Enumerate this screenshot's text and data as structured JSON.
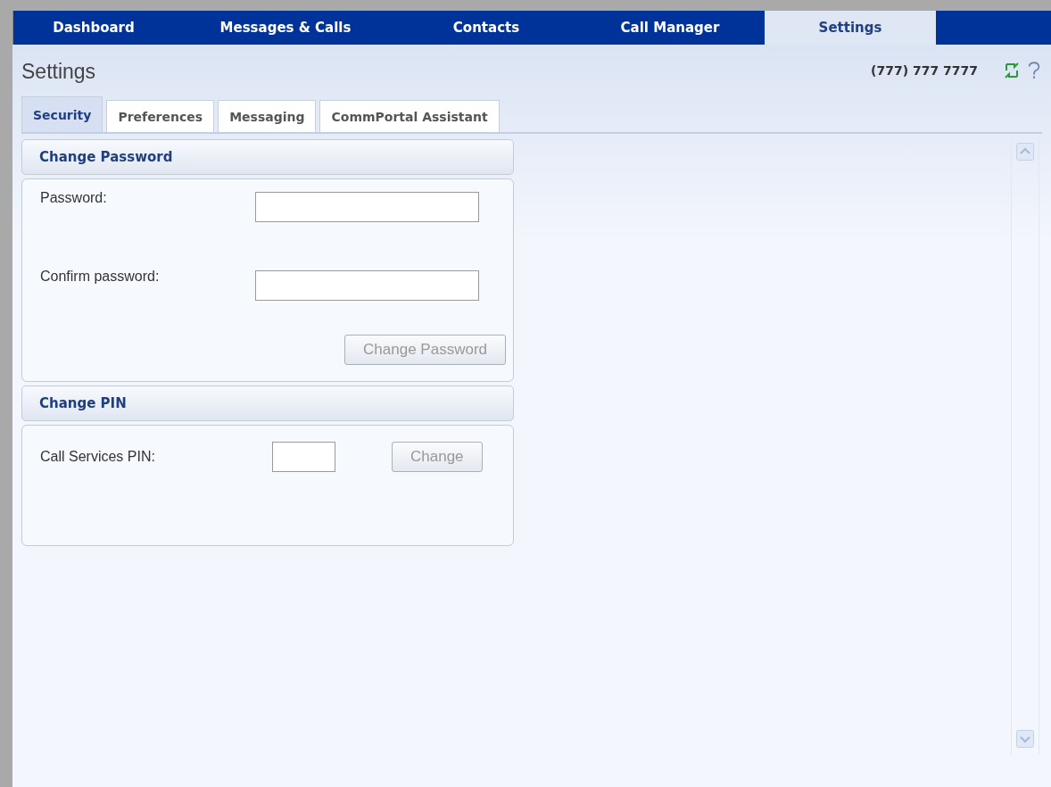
{
  "nav": [
    {
      "label": "Dashboard",
      "selected": false
    },
    {
      "label": "Messages & Calls",
      "selected": false
    },
    {
      "label": "Contacts",
      "selected": false
    },
    {
      "label": "Call Manager",
      "selected": false
    },
    {
      "label": "Settings",
      "selected": true
    }
  ],
  "page_title": "Settings",
  "phone": "(777) 777 7777",
  "tabs": [
    {
      "label": "Security",
      "selected": true
    },
    {
      "label": "Preferences",
      "selected": false
    },
    {
      "label": "Messaging",
      "selected": false
    },
    {
      "label": "CommPortal Assistant",
      "selected": false
    }
  ],
  "sections": [
    {
      "title": "Change Password",
      "kind": "password",
      "fields": [
        {
          "label": "Password:"
        },
        {
          "label": "Confirm password:"
        }
      ],
      "button": {
        "label": "Change Password",
        "disabled": true
      }
    },
    {
      "title": "Change PIN",
      "kind": "pin",
      "fields": [
        {
          "label": "Call Services PIN:"
        }
      ],
      "button": {
        "label": "Change",
        "disabled": true
      }
    }
  ]
}
